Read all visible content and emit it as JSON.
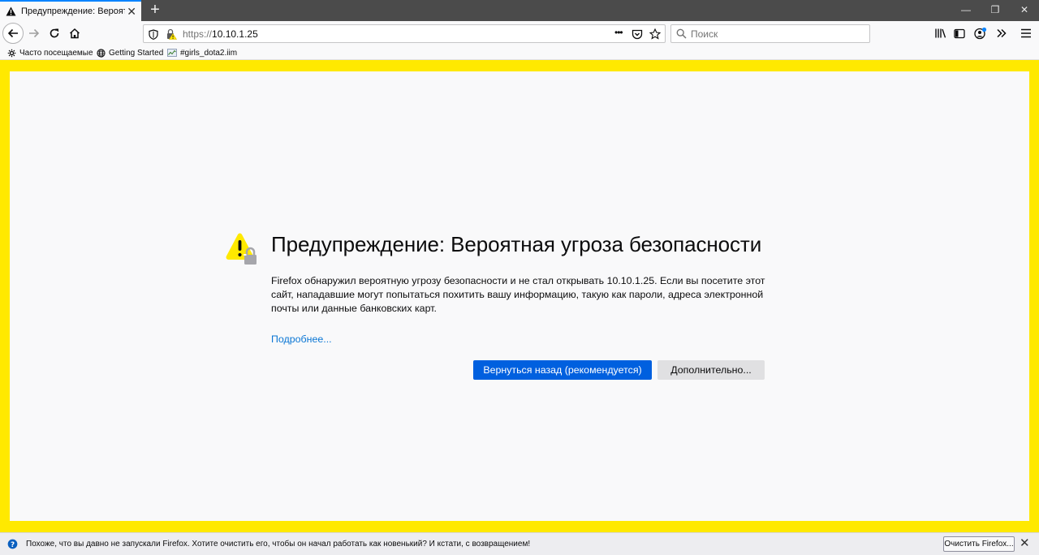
{
  "tab": {
    "title": "Предупреждение: Вероятная угроза",
    "close": "✕",
    "new_tab": "+"
  },
  "window_controls": {
    "minimize": "—",
    "restore": "❐",
    "close": "✕"
  },
  "navbar": {
    "url_scheme": "https://",
    "url_host": "10.10.1.25",
    "page_actions": "•••",
    "search_placeholder": "Поиск"
  },
  "bookmarks": [
    {
      "label": "Часто посещаемые",
      "icon": "gear-icon"
    },
    {
      "label": "Getting Started",
      "icon": "globe-icon"
    },
    {
      "label": "#girls_dota2.iim",
      "icon": "imacros-icon"
    }
  ],
  "error_page": {
    "title": "Предупреждение: Вероятная угроза безопасности",
    "description": "Firefox обнаружил вероятную угрозу безопасности и не стал открывать 10.10.1.25. Если вы посетите этот сайт, нападавшие могут попытаться похитить вашу информацию, такую как пароли, адреса электронной почты или данные банковских карт.",
    "learn_more": "Подробнее...",
    "go_back_button": "Вернуться назад (рекомендуется)",
    "advanced_button": "Дополнительно..."
  },
  "notification": {
    "text": "Похоже, что вы давно не запускали Firefox. Хотите очистить его, чтобы он начал работать как новенький? И кстати, с возвращением!",
    "button": "Очистить Firefox...",
    "close": "✕"
  },
  "colors": {
    "frame_yellow": "#ffe900",
    "primary_blue": "#0060df",
    "link_blue": "#0a76d4",
    "warning_yellow": "#ffe900"
  }
}
